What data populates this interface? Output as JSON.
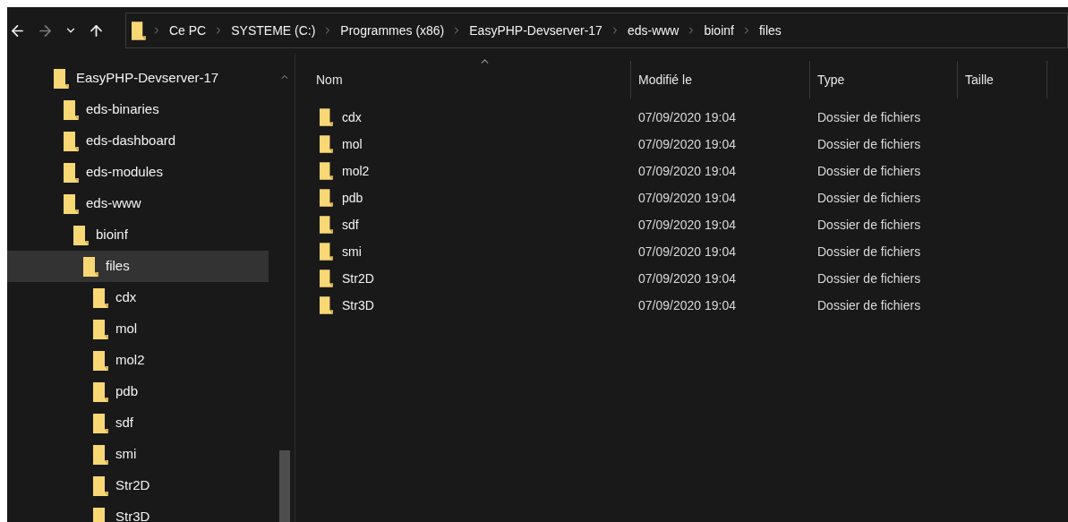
{
  "nav": [
    {
      "kind": "back",
      "disabled": false
    },
    {
      "kind": "forward",
      "disabled": true
    },
    {
      "kind": "recent",
      "disabled": false
    },
    {
      "kind": "up",
      "disabled": false
    }
  ],
  "breadcrumbs": [
    "Ce PC",
    "SYSTEME (C:)",
    "Programmes (x86)",
    "EasyPHP-Devserver-17",
    "eds-www",
    "bioinf",
    "files"
  ],
  "sidebar": {
    "tree": [
      {
        "label": "EasyPHP-Devserver-17",
        "selected": false,
        "children": [
          {
            "label": "eds-binaries",
            "selected": false
          },
          {
            "label": "eds-dashboard",
            "selected": false
          },
          {
            "label": "eds-modules",
            "selected": false
          },
          {
            "label": "eds-www",
            "selected": false,
            "children": [
              {
                "label": "bioinf",
                "selected": false,
                "children": [
                  {
                    "label": "files",
                    "selected": true,
                    "children": [
                      {
                        "label": "cdx",
                        "selected": false
                      },
                      {
                        "label": "mol",
                        "selected": false
                      },
                      {
                        "label": "mol2",
                        "selected": false
                      },
                      {
                        "label": "pdb",
                        "selected": false
                      },
                      {
                        "label": "sdf",
                        "selected": false
                      },
                      {
                        "label": "smi",
                        "selected": false
                      },
                      {
                        "label": "Str2D",
                        "selected": false
                      },
                      {
                        "label": "Str3D",
                        "selected": false
                      }
                    ]
                  }
                ]
              }
            ]
          }
        ]
      }
    ]
  },
  "table": {
    "columns": [
      {
        "label": "Nom",
        "sorted": true
      },
      {
        "label": "Modifié le",
        "sorted": false
      },
      {
        "label": "Type",
        "sorted": false
      },
      {
        "label": "Taille",
        "sorted": false
      }
    ],
    "rows": [
      {
        "name": "cdx",
        "modified": "07/09/2020 19:04",
        "type": "Dossier de fichiers"
      },
      {
        "name": "mol",
        "modified": "07/09/2020 19:04",
        "type": "Dossier de fichiers"
      },
      {
        "name": "mol2",
        "modified": "07/09/2020 19:04",
        "type": "Dossier de fichiers"
      },
      {
        "name": "pdb",
        "modified": "07/09/2020 19:04",
        "type": "Dossier de fichiers"
      },
      {
        "name": "sdf",
        "modified": "07/09/2020 19:04",
        "type": "Dossier de fichiers"
      },
      {
        "name": "smi",
        "modified": "07/09/2020 19:04",
        "type": "Dossier de fichiers"
      },
      {
        "name": "Str2D",
        "modified": "07/09/2020 19:04",
        "type": "Dossier de fichiers"
      },
      {
        "name": "Str3D",
        "modified": "07/09/2020 19:04",
        "type": "Dossier de fichiers"
      }
    ]
  }
}
